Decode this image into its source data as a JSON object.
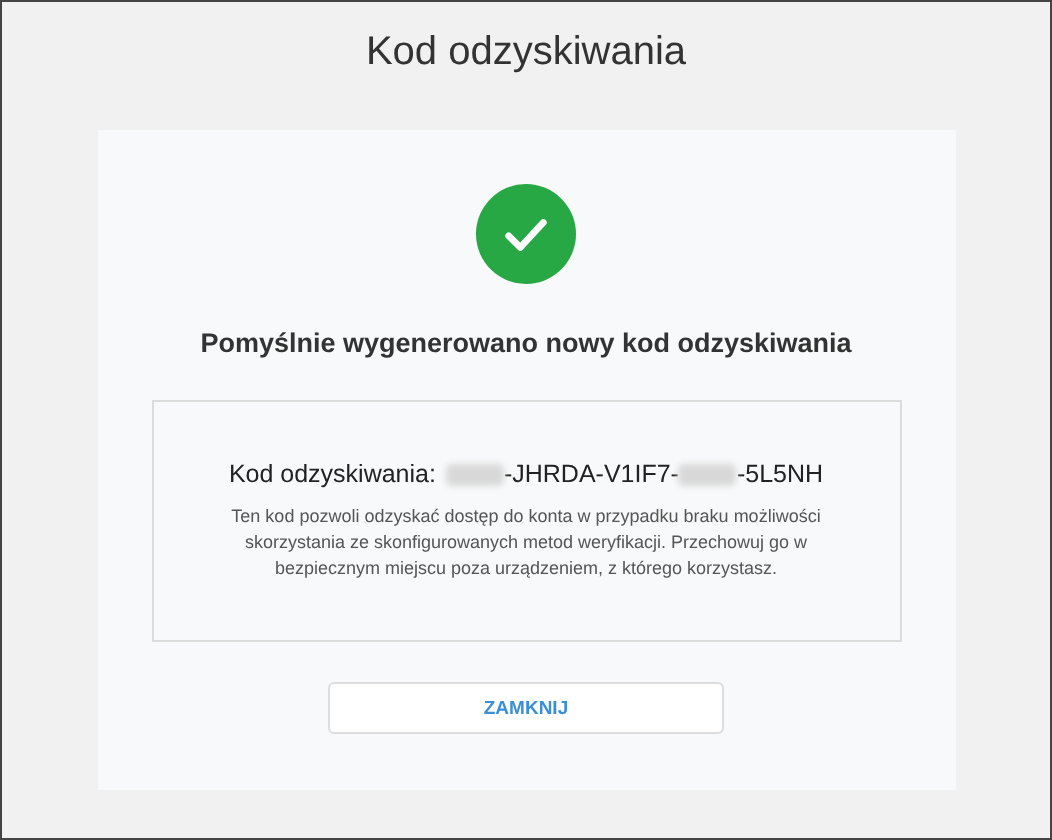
{
  "window": {
    "title": "Kod odzyskiwania"
  },
  "card": {
    "succeeded": true,
    "heading": "Pomyślnie wygenerowano nowy kod odzyskiwania",
    "code_label": "Kod odzyskiwania:",
    "code_segments": [
      {
        "kind": "redacted"
      },
      {
        "kind": "text",
        "text": "-JHRDA-V1IF7-"
      },
      {
        "kind": "redacted"
      },
      {
        "kind": "text",
        "text": "-5L5NH"
      }
    ],
    "description": "Ten kod pozwoli odzyskać dostęp do konta w przypadku braku możliwości skorzystania ze skonfigurowanych metod weryfikacji. Przechowuj go w bezpiecznym miejscu poza urządzeniem, z którego korzystasz.",
    "button": "ZAMKNIJ"
  }
}
